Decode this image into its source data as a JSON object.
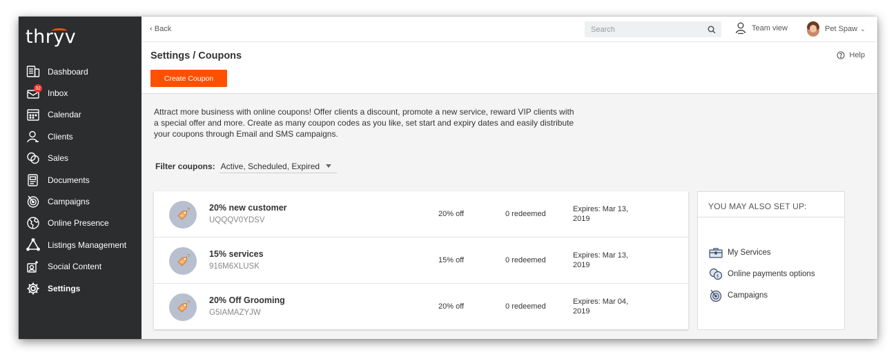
{
  "sidebar": {
    "logo": "thryv",
    "items": [
      {
        "label": "Dashboard",
        "icon": "dashboard-icon"
      },
      {
        "label": "Inbox",
        "icon": "inbox-icon",
        "badge": "32"
      },
      {
        "label": "Calendar",
        "icon": "calendar-icon"
      },
      {
        "label": "Clients",
        "icon": "clients-icon"
      },
      {
        "label": "Sales",
        "icon": "sales-icon"
      },
      {
        "label": "Documents",
        "icon": "documents-icon"
      },
      {
        "label": "Campaigns",
        "icon": "campaigns-icon"
      },
      {
        "label": "Online Presence",
        "icon": "globe-icon"
      },
      {
        "label": "Listings Management",
        "icon": "listings-icon"
      },
      {
        "label": "Social Content",
        "icon": "social-icon"
      },
      {
        "label": "Settings",
        "icon": "gear-icon",
        "active": true
      }
    ]
  },
  "topbar": {
    "back_label": "Back",
    "search_placeholder": "Search",
    "team_label": "Team view",
    "user_name": "Pet Spaw"
  },
  "header": {
    "title": "Settings / Coupons",
    "help_label": "Help",
    "create_button": "Create Coupon"
  },
  "intro": {
    "line1": "Attract more business with online coupons! Offer clients a discount, promote a new service, reward VIP clients with",
    "line2": "a special offer and more. Create as many coupon codes as you like, set start and expiry dates and easily distribute",
    "line3": "your coupons through Email and SMS campaigns."
  },
  "filter": {
    "label": "Filter coupons:",
    "value": "Active, Scheduled, Expired"
  },
  "coupons": [
    {
      "name": "20% new customer",
      "code": "UQQQV0YDSV",
      "discount": "20% off",
      "redeemed": "0 redeemed",
      "expires_1": "Expires: Mar 13,",
      "expires_2": "2019"
    },
    {
      "name": "15% services",
      "code": "916M6XLUSK",
      "discount": "15% off",
      "redeemed": "0 redeemed",
      "expires_1": "Expires: Mar 13,",
      "expires_2": "2019"
    },
    {
      "name": "20% Off Grooming",
      "code": "G5IAMAZYJW",
      "discount": "20% off",
      "redeemed": "0 redeemed",
      "expires_1": "Expires: Mar 04,",
      "expires_2": "2019"
    }
  ],
  "also_setup": {
    "title": "YOU MAY ALSO SET UP:",
    "items": [
      {
        "label": "My Services",
        "icon": "briefcase-icon"
      },
      {
        "label": "Online payments options",
        "icon": "coins-icon"
      },
      {
        "label": "Campaigns",
        "icon": "target-icon"
      }
    ]
  },
  "colors": {
    "accent": "#ff5000",
    "sidebar_bg": "#2b2d2f",
    "tag_circle": "#b8c0cf",
    "tag_fill": "#f2a65a"
  }
}
